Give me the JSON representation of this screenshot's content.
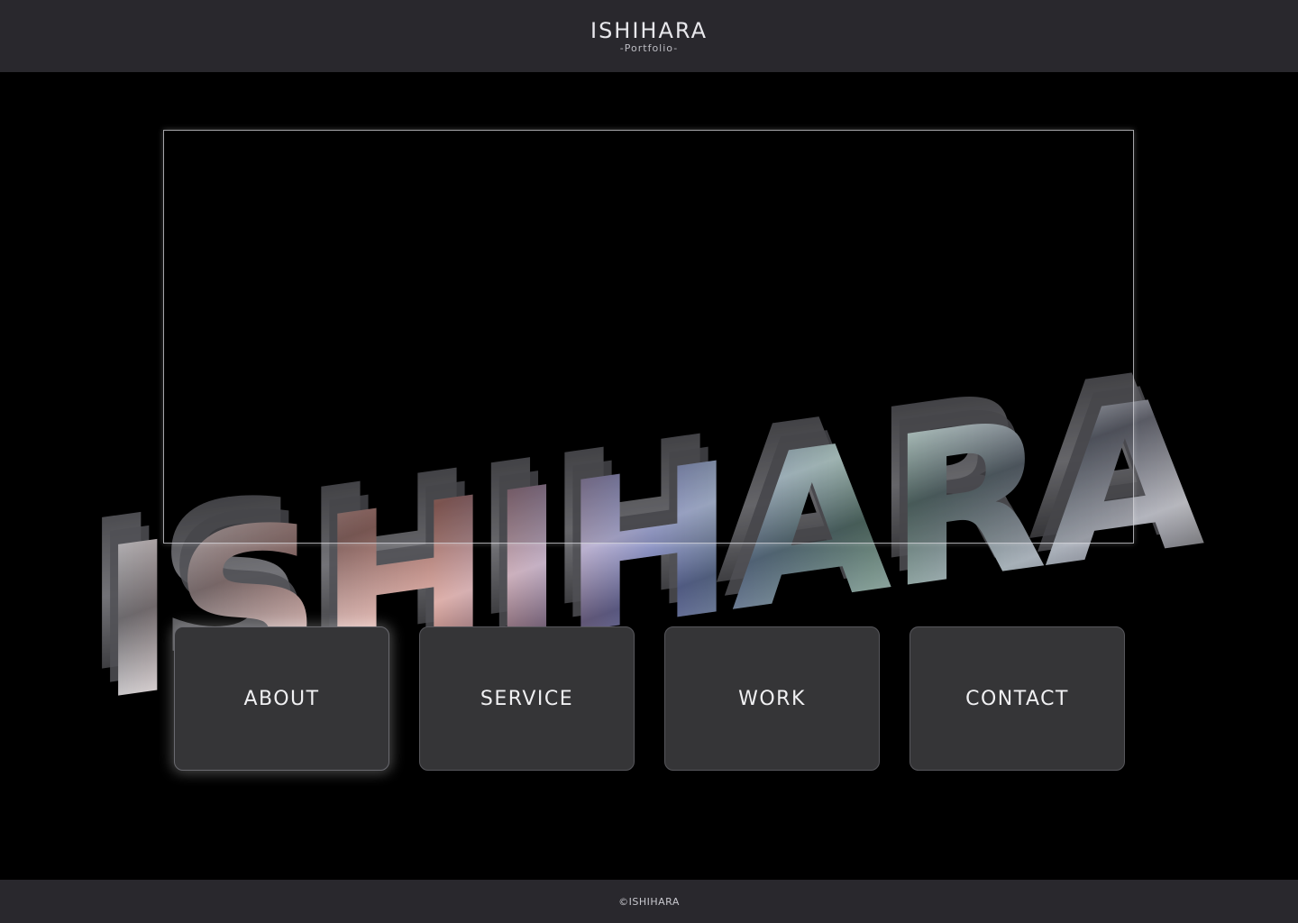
{
  "header": {
    "title": "ISHIHARA",
    "subtitle": "-Portfolio-"
  },
  "hero": {
    "art_text": "ISHIHARA",
    "art_colors": [
      "#8e8e92",
      "#c9c9cc",
      "#3e3e42",
      "#d84a2e",
      "#3a4fd6"
    ]
  },
  "nav": {
    "items": [
      {
        "label": "ABOUT",
        "active": true
      },
      {
        "label": "SERVICE",
        "active": false
      },
      {
        "label": "WORK",
        "active": false
      },
      {
        "label": "CONTACT",
        "active": false
      }
    ]
  },
  "footer": {
    "copyright": "©ISHIHARA"
  },
  "colors": {
    "header_bg": "#29282d",
    "page_bg": "#000000",
    "button_bg": "#353537",
    "text": "#f0f0f2"
  }
}
